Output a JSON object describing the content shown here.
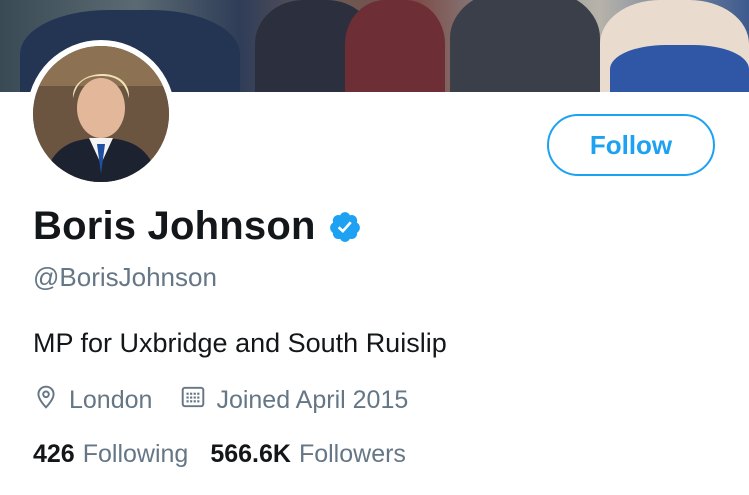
{
  "profile": {
    "name": "Boris Johnson",
    "handle": "@BorisJohnson",
    "bio": "MP for Uxbridge and South Ruislip",
    "location": "London",
    "joined": "Joined April 2015",
    "verified": true
  },
  "actions": {
    "follow_label": "Follow"
  },
  "stats": {
    "following_count": "426",
    "following_label": "Following",
    "followers_count": "566.6K",
    "followers_label": "Followers"
  },
  "icons": {
    "verified": "verified-badge-icon",
    "location": "location-pin-icon",
    "calendar": "calendar-icon"
  },
  "colors": {
    "accent": "#1da1f2",
    "text": "#14171a",
    "secondary": "#657786"
  }
}
